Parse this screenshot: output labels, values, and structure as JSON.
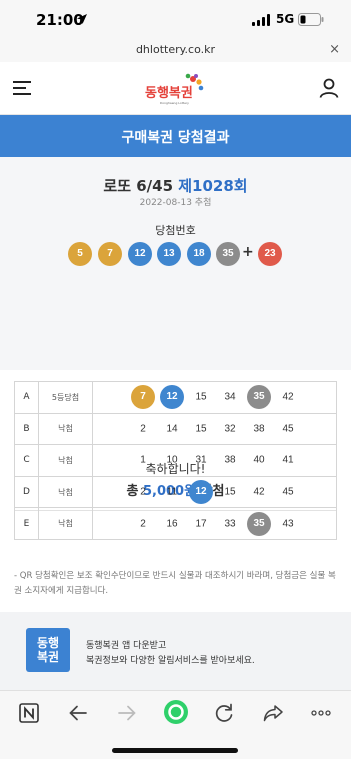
{
  "status_bar": {
    "time": "21:00",
    "network": "5G"
  },
  "url_bar": {
    "domain": "dhlottery.co.kr",
    "close_icon": "×"
  },
  "header": {
    "logo_text": "동행복권",
    "logo_subtext": "Donghaeng Lottery"
  },
  "page": {
    "title": "구매복권 당첨결과"
  },
  "draw": {
    "game": "로또 6/45",
    "round": "제1028회",
    "date": "2022-08-13 추첨",
    "winning_label": "당첨번호",
    "numbers": [
      "5",
      "7",
      "12",
      "13",
      "18",
      "35"
    ],
    "plus": "+",
    "bonus": "23"
  },
  "prize": {
    "congrats": "축하합니다!",
    "prefix": "총 ",
    "amount": "5,000원",
    "suffix": " 당첨"
  },
  "tickets": [
    {
      "id": "A",
      "status": "5등당첨",
      "numbers": [
        "7",
        "12",
        "15",
        "34",
        "35",
        "42"
      ],
      "hits": [
        0,
        1,
        4
      ]
    },
    {
      "id": "B",
      "status": "낙첨",
      "numbers": [
        "2",
        "14",
        "15",
        "32",
        "38",
        "45"
      ],
      "hits": []
    },
    {
      "id": "C",
      "status": "낙첨",
      "numbers": [
        "1",
        "10",
        "31",
        "38",
        "40",
        "41"
      ],
      "hits": []
    },
    {
      "id": "D",
      "status": "낙첨",
      "numbers": [
        "2",
        "11",
        "12",
        "15",
        "42",
        "45"
      ],
      "hits": [
        2
      ]
    },
    {
      "id": "E",
      "status": "낙첨",
      "numbers": [
        "2",
        "16",
        "17",
        "33",
        "35",
        "43"
      ],
      "hits": [
        4
      ]
    }
  ],
  "notice": "- QR 당첨확인은 보조 확인수단이므로 반드시 실물과 대조하시기 바라며, 당첨금은 실물 복권 소지자에게 지급합니다.",
  "app_promo": {
    "icon_text_1": "동행",
    "icon_text_2": "복권",
    "line1": "동행복권 앱 다운받고",
    "line2": "복권정보와 다양한 알림서비스를 받아보세요."
  },
  "colors": {
    "primary_blue": "#3c82d2",
    "ball_yellow": "#dba43b",
    "ball_blue": "#3f86cf",
    "ball_red": "#e05a4b",
    "ball_gray": "#8c8c8c",
    "browser_green": "#2fd06a"
  },
  "icons": {
    "status": [
      "location-arrow-icon",
      "signal-icon",
      "battery-icon"
    ],
    "header": [
      "hamburger-menu-icon",
      "user-icon"
    ],
    "browser": [
      "naver-n-icon",
      "back-arrow-icon",
      "forward-arrow-icon",
      "naver-green-dot-icon",
      "reload-icon",
      "share-icon",
      "more-icon"
    ]
  }
}
